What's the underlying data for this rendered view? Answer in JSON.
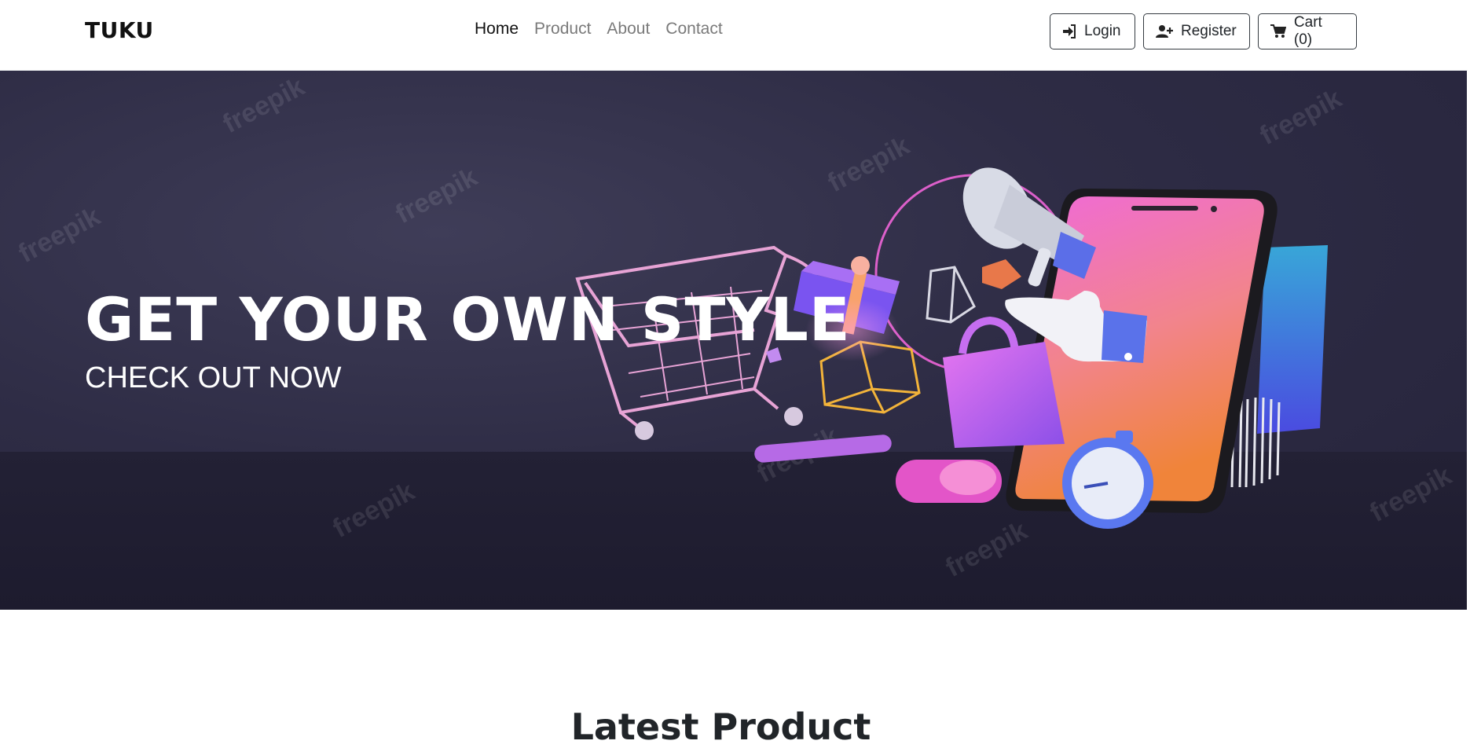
{
  "navbar": {
    "brand": "TUKU",
    "links": [
      {
        "label": "Home",
        "active": true
      },
      {
        "label": "Product",
        "active": false
      },
      {
        "label": "About",
        "active": false
      },
      {
        "label": "Contact",
        "active": false
      }
    ],
    "buttons": {
      "login": "Login",
      "register": "Register",
      "cart": "Cart (0)"
    }
  },
  "hero": {
    "title": "GET YOUR OWN STYLE",
    "subtitle": "CHECK OUT NOW",
    "watermark": "freepik"
  },
  "section": {
    "title": "Latest Product"
  },
  "colors": {
    "hero_bg": "#2e2c45",
    "accent_pink": "#e25bd6",
    "accent_orange": "#f08a3a"
  }
}
